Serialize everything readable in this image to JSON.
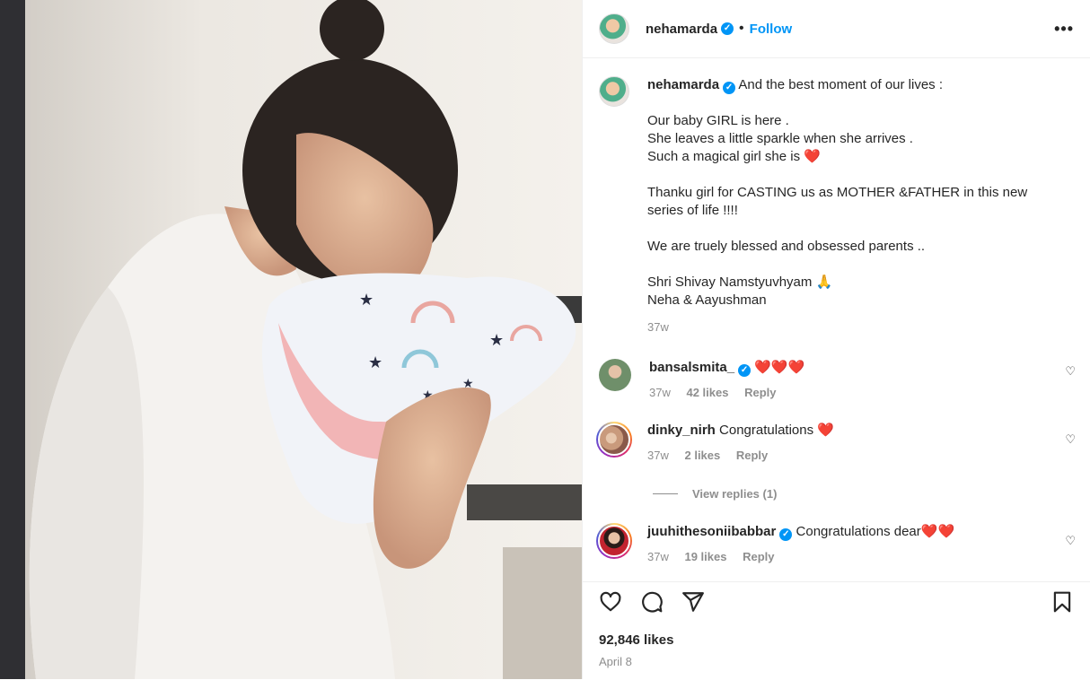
{
  "post": {
    "username": "nehamarda",
    "verified_mark": "✓",
    "dot": "•",
    "follow_label": "Follow",
    "more_label": "•••",
    "caption_lines": [
      "And the best moment of our lives :",
      "Our baby GIRL is here .",
      "She leaves a little sparkle when she arrives .",
      "Such a magical girl she is ❤️",
      "Thanku girl for CASTING us as MOTHER &FATHER in this new series of life !!!!",
      "We are truely blessed and obsessed parents ..",
      "Shri Shivay Namstyuvhyam 🙏",
      "Neha & Aayushman"
    ],
    "caption_age": "37w"
  },
  "comments": [
    {
      "username": "bansalsmita_",
      "verified": true,
      "text": "❤️❤️❤️",
      "age": "37w",
      "likes": "42 likes",
      "reply": "Reply",
      "avatar_color": "#6f8f6a"
    },
    {
      "username": "dinky_nirh",
      "verified": false,
      "text": "Congratulations ❤️",
      "age": "37w",
      "likes": "2 likes",
      "reply": "Reply",
      "avatar_color": "#c99a7c"
    },
    {
      "username": "juuhithesoniibabbar",
      "verified": true,
      "text": "Congratulations dear❤️❤️",
      "age": "37w",
      "likes": "19 likes",
      "reply": "Reply",
      "avatar_color": "#c2242f"
    }
  ],
  "view_replies": "View replies (1)",
  "footer": {
    "likes": "92,846 likes",
    "date": "April 8"
  },
  "icons": [
    "heart-icon",
    "comment-icon",
    "share-icon",
    "bookmark-icon",
    "more-icon",
    "verified-icon"
  ],
  "colors": {
    "accent": "#0095f6",
    "text": "#262626",
    "muted": "#8e8e8e",
    "heart": "#e0182d"
  }
}
